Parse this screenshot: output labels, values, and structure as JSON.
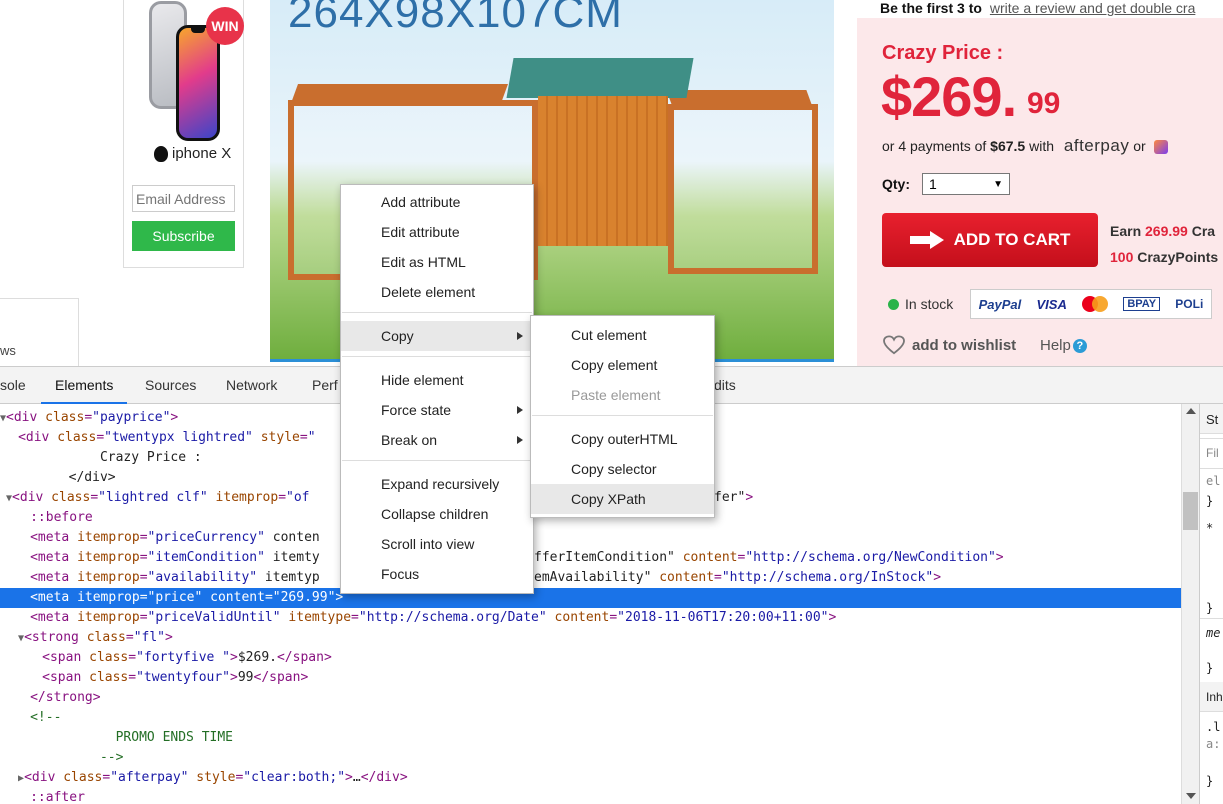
{
  "sidebar": {
    "badge": "WIN",
    "phone_label": "iphone X",
    "email_placeholder": "Email Address",
    "subscribe": "Subscribe",
    "stub_text": "ws"
  },
  "product": {
    "dimensions": "264X98X107CM"
  },
  "pricing": {
    "review_prefix": "Be the first 3 to",
    "review_link": "write a review and get double cra",
    "crazy_label": "Crazy Price :",
    "price_main": "$269.",
    "price_cents": "99",
    "payments_prefix": "or 4 payments of",
    "payments_amount": "$67.5",
    "payments_with": "with",
    "afterpay": "afterpay",
    "or": "or",
    "qty_label": "Qty:",
    "qty_value": "1",
    "add_to_cart": "ADD TO CART",
    "earn_prefix": "Earn",
    "earn_amount": "269.99",
    "earn_suffix": "Cra",
    "points_amount": "100",
    "points_label": "CrazyPoints",
    "stock": "In stock",
    "wishlist": "add to wishlist",
    "help": "Help",
    "pay_methods": [
      "PayPal",
      "VISA",
      "BPAY",
      "POLi"
    ]
  },
  "devtools": {
    "tabs": [
      "sole",
      "Elements",
      "Sources",
      "Network",
      "Perf",
      "dits"
    ],
    "active_tab": "Elements",
    "dom_lines": [
      {
        "indent": "",
        "tri": "▼",
        "html": "<div class=\"payprice\">"
      },
      {
        "indent": "  ",
        "tri": "",
        "html": "<div class=\"twentypx lightred\" style=\""
      },
      {
        "indent": "",
        "tri": "",
        "text": "            Crazy Price :"
      },
      {
        "indent": "",
        "tri": "",
        "text": "        </div>"
      },
      {
        "indent": " ",
        "tri": "▼",
        "html": "<div class=\"lightred clf\" itemprop=\"of"
      },
      {
        "indent": "    ",
        "tri": "",
        "text": "::before"
      },
      {
        "indent": "    ",
        "tri": "",
        "html": "<meta itemprop=\"priceCurrency\" conten"
      },
      {
        "indent": "    ",
        "tri": "",
        "html": "<meta itemprop=\"itemCondition\" itemty"
      },
      {
        "indent": "    ",
        "tri": "",
        "html": "<meta itemprop=\"availability\" itemtyp"
      },
      {
        "indent": "    ",
        "tri": "",
        "html": "<meta itemprop=\"price\" content=\"269.99\">",
        "selected": true
      },
      {
        "indent": "    ",
        "tri": "",
        "html": "<meta itemprop=\"priceValidUntil\" itemtype=\"http://schema.org/Date\" content=\"2018-11-06T17:20:00+11:00\">"
      },
      {
        "indent": "   ",
        "tri": "▼",
        "html": "<strong class=\"fl\">"
      },
      {
        "indent": "      ",
        "tri": "",
        "html": "<span class=\"fortyfive \">$269.</span>"
      },
      {
        "indent": "      ",
        "tri": "",
        "html": "<span class=\"twentyfour\">99</span>"
      },
      {
        "indent": "    ",
        "tri": "",
        "html": "</strong>"
      },
      {
        "indent": "    ",
        "tri": "",
        "text": "<!--"
      },
      {
        "indent": "",
        "tri": "",
        "text": "              PROMO ENDS TIME"
      },
      {
        "indent": "",
        "tri": "",
        "text": "            -->"
      },
      {
        "indent": "   ",
        "tri": "▶",
        "html": "<div class=\"afterpay\" style=\"clear:both;\">…</div>"
      },
      {
        "indent": "    ",
        "tri": "",
        "text": "::after"
      }
    ],
    "right_fragments": [
      {
        "row": 4,
        "text": "fer\">"
      },
      {
        "row": 7,
        "text": "fferItemCondition\" content=\"http://schema.org/NewCondition\">"
      },
      {
        "row": 8,
        "text": "emAvailability\" content=\"http://schema.org/InStock\">"
      }
    ],
    "styles_pane": [
      "St",
      "Fil",
      "el",
      "}",
      "*",
      "}",
      "me",
      "}",
      "Inh",
      ".l",
      "a:",
      "}"
    ]
  },
  "context_menu": {
    "items": [
      "Add attribute",
      "Edit attribute",
      "Edit as HTML",
      "Delete element",
      "Copy",
      "Hide element",
      "Force state",
      "Break on",
      "Expand recursively",
      "Collapse children",
      "Scroll into view",
      "Focus"
    ],
    "submenu_items": [
      "Cut element",
      "Copy element",
      "Paste element",
      "Copy outerHTML",
      "Copy selector",
      "Copy XPath"
    ],
    "highlighted_item": "Copy",
    "highlighted_subitem": "Copy XPath",
    "disabled_subitem": "Paste element"
  }
}
